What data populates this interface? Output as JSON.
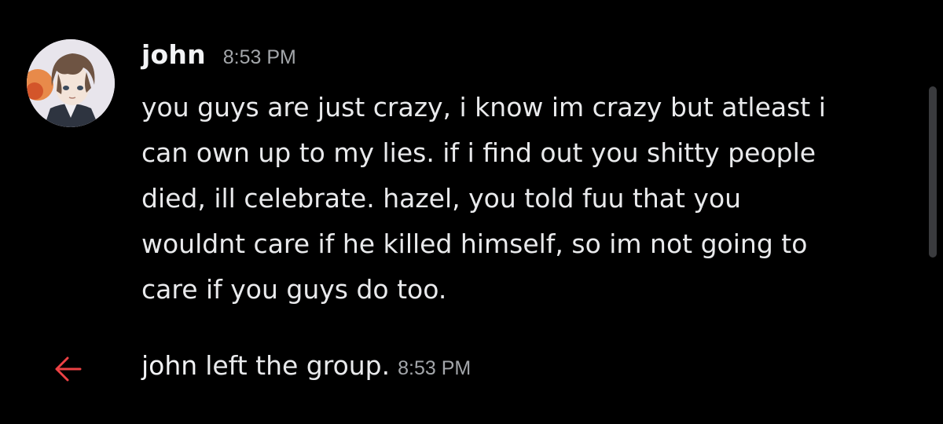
{
  "message": {
    "author": "john",
    "timestamp": "8:53 PM",
    "avatar_icon": "anime-boy-avatar",
    "lines": [
      "you guys are just crazy, i know im crazy but atleast i",
      "can own up to my lies. if i find out you shitty people",
      "died, ill celebrate. hazel, you told fuu that you",
      "wouldnt care if he killed himself, so im not going to",
      "care if you guys do too."
    ]
  },
  "system_event": {
    "user": "john",
    "action": "left the group.",
    "timestamp": "8:53 PM",
    "icon": "left-arrow-icon",
    "icon_color": "#ed4245"
  },
  "colors": {
    "background": "#000000",
    "text": "#e9eaec",
    "muted": "#a3a6aa"
  }
}
